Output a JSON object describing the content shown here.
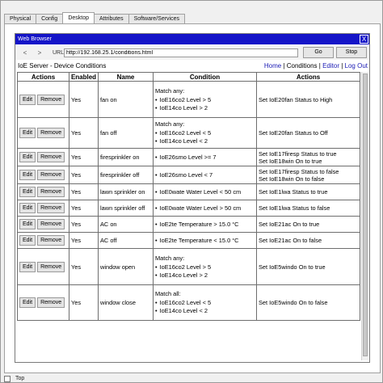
{
  "tabs": [
    "Physical",
    "Config",
    "Desktop",
    "Attributes",
    "Software/Services"
  ],
  "browser": {
    "title": "Web Browser",
    "close_label": "X",
    "back": "<",
    "forward": ">",
    "url_label": "URL",
    "url": "http://192.168.25.1/conditions.html",
    "go_label": "Go",
    "stop_label": "Stop"
  },
  "page": {
    "title": "IoE Server - Device Conditions",
    "links": {
      "home": "Home",
      "conditions": "Conditions",
      "editor": "Editor",
      "logout": "Log Out",
      "sep": " | "
    }
  },
  "table": {
    "headers": [
      "Actions",
      "Enabled",
      "Name",
      "Condition",
      "Actions"
    ],
    "edit_label": "Edit",
    "remove_label": "Remove",
    "rows": [
      {
        "enabled": "Yes",
        "name": "fan on",
        "cond_head": "Match any:",
        "conds": [
          "IoE16co2 Level > 5",
          "IoE14co Level > 2"
        ],
        "acts": [
          "Set IoE20fan Status to High"
        ]
      },
      {
        "enabled": "Yes",
        "name": "fan off",
        "cond_head": "Match any:",
        "conds": [
          "IoE16co2 Level < 5",
          "IoE14co Level < 2"
        ],
        "acts": [
          "Set IoE20fan Status to Off"
        ]
      },
      {
        "enabled": "Yes",
        "name": "firesprinkler on",
        "cond_head": "",
        "conds": [
          "IoE26smo Level >= 7"
        ],
        "acts": [
          "Set IoE17firesp Status to true",
          "Set IoE18win On to true"
        ]
      },
      {
        "enabled": "Yes",
        "name": "firesprinkler off",
        "cond_head": "",
        "conds": [
          "IoE26smo Level < 7"
        ],
        "acts": [
          "Set IoE17firesp Status to false",
          "Set IoE18win On to false"
        ]
      },
      {
        "enabled": "Yes",
        "name": "lawn sprinkler on",
        "cond_head": "",
        "conds": [
          "IoE0wate Water Level < 50 cm"
        ],
        "acts": [
          "Set IoE1lwa Status to true"
        ]
      },
      {
        "enabled": "Yes",
        "name": "lawn sprinkler off",
        "cond_head": "",
        "conds": [
          "IoE0wate Water Level > 50 cm"
        ],
        "acts": [
          "Set IoE1lwa Status to false"
        ]
      },
      {
        "enabled": "Yes",
        "name": "AC on",
        "cond_head": "",
        "conds": [
          "IoE2te Temperature > 15.0 °C"
        ],
        "acts": [
          "Set IoE21ac On to true"
        ]
      },
      {
        "enabled": "Yes",
        "name": "AC off",
        "cond_head": "",
        "conds": [
          "IoE2te Temperature < 15.0 °C"
        ],
        "acts": [
          "Set IoE21ac On to false"
        ]
      },
      {
        "enabled": "Yes",
        "name": "window open",
        "cond_head": "Match any:",
        "conds": [
          "IoE16co2 Level > 5",
          "IoE14co Level > 2"
        ],
        "acts": [
          "Set IoE5windo On to true"
        ]
      },
      {
        "enabled": "Yes",
        "name": "window close",
        "cond_head": "Match all:",
        "conds": [
          "IoE16co2 Level < 5",
          "IoE14co Level < 2"
        ],
        "acts": [
          "Set IoE5windo On to false"
        ]
      }
    ]
  },
  "bottom": {
    "top_label": "Top"
  }
}
